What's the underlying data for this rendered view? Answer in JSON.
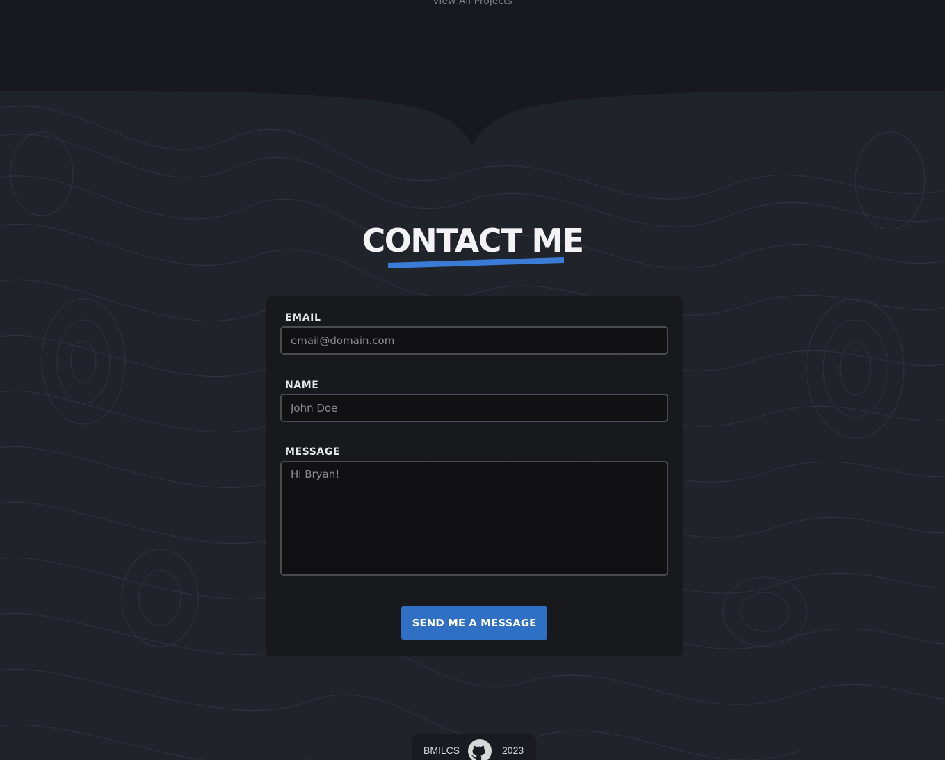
{
  "top_section": {
    "view_all_link": "View All Projects"
  },
  "contact": {
    "heading": "CONTACT ME",
    "accent_color": "#3a7bd5",
    "email": {
      "label": "EMAIL",
      "placeholder": "email@domain.com",
      "value": ""
    },
    "name": {
      "label": "NAME",
      "placeholder": "John Doe",
      "value": ""
    },
    "message": {
      "label": "MESSAGE",
      "placeholder": "Hi Bryan!",
      "value": ""
    },
    "submit_label": "SEND ME A MESSAGE",
    "submit_color": "#2f6fc4"
  },
  "footer": {
    "left_text": "BMILCS",
    "icon": "github-icon",
    "right_text": "2023"
  }
}
